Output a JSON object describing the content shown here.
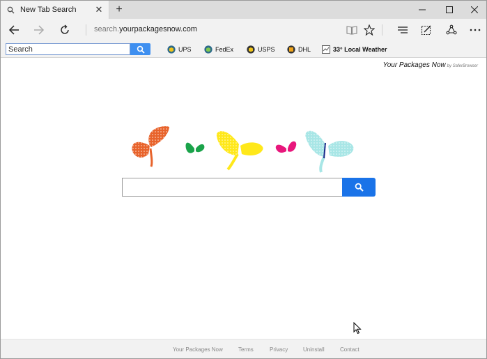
{
  "browser": {
    "tab": {
      "title": "New Tab Search",
      "close_glyph": "✕"
    },
    "new_tab_glyph": "+",
    "window_controls": {
      "minimize": "—",
      "maximize": "☐",
      "close": "✕"
    },
    "address": {
      "prefix": "search.",
      "domain": "yourpackagesnow.com"
    }
  },
  "toolbar": {
    "search": {
      "placeholder": "Search",
      "value": ""
    },
    "items": [
      {
        "label": "UPS",
        "icon": "package-icon"
      },
      {
        "label": "FedEx",
        "icon": "package-icon"
      },
      {
        "label": "USPS",
        "icon": "package-icon"
      },
      {
        "label": "DHL",
        "icon": "package-icon"
      },
      {
        "label": "33° Local Weather",
        "icon": "weather-icon"
      }
    ]
  },
  "page": {
    "brand": {
      "name": "Your Packages Now",
      "by": "by SaferBrowser"
    },
    "search": {
      "value": ""
    }
  },
  "footer": {
    "links": [
      "Your Packages Now",
      "Terms",
      "Privacy",
      "Uninstall",
      "Contact"
    ]
  },
  "colors": {
    "accent_blue": "#1a73e8",
    "toolbar_blue": "#3e8ff0",
    "butterfly_orange": "#e8632b",
    "butterfly_green": "#1aa34a",
    "butterfly_yellow": "#ffe81a",
    "butterfly_pink": "#e8177c",
    "butterfly_cyan": "#a8e6e6"
  }
}
